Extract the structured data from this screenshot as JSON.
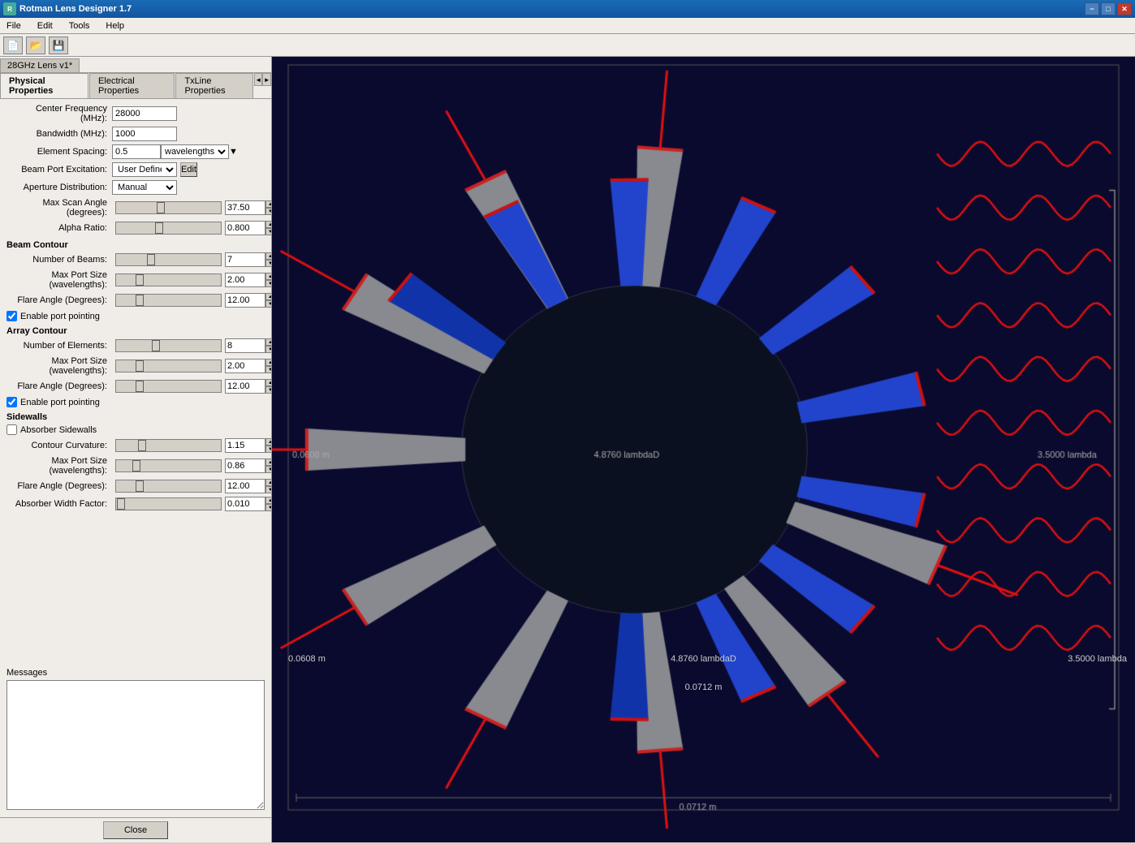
{
  "titleBar": {
    "title": "Rotman Lens Designer 1.7",
    "minimizeLabel": "−",
    "maximizeLabel": "□",
    "closeLabel": "✕"
  },
  "menuBar": {
    "items": [
      "File",
      "Edit",
      "Tools",
      "Help"
    ]
  },
  "toolbar": {
    "buttons": [
      "📄",
      "📂",
      "💾"
    ]
  },
  "lensTab": {
    "label": "28GHz Lens v1*"
  },
  "tabs": {
    "items": [
      "Physical Properties",
      "Electrical Properties",
      "TxLine Properties"
    ],
    "activeIndex": 0,
    "navPrev": "◄",
    "navNext": "►"
  },
  "fields": {
    "centerFreq": {
      "label": "Center Frequency (MHz):",
      "value": "28000"
    },
    "bandwidth": {
      "label": "Bandwidth (MHz):",
      "value": "1000"
    },
    "elementSpacing": {
      "label": "Element Spacing:",
      "value": "0.5",
      "units": "wavelengths"
    },
    "beamPortExcitation": {
      "label": "Beam Port Excitation:",
      "value": "User Defined",
      "buttonLabel": "Edit"
    },
    "apertureDistribution": {
      "label": "Aperture Distribution:",
      "value": "Manual"
    },
    "maxScanAngle": {
      "label": "Max Scan Angle (degrees):",
      "value": "37.50"
    },
    "alphaRatio": {
      "label": "Alpha Ratio:",
      "value": "0.800"
    }
  },
  "beamContour": {
    "title": "Beam Contour",
    "numberOfBeams": {
      "label": "Number of Beams:",
      "value": "7"
    },
    "maxPortSize": {
      "label": "Max Port Size (wavelengths):",
      "value": "2.00"
    },
    "flareAngle": {
      "label": "Flare Angle (Degrees):",
      "value": "12.00"
    },
    "enablePortPointing": {
      "label": "Enable port pointing",
      "checked": true
    }
  },
  "arrayContour": {
    "title": "Array Contour",
    "numberOfElements": {
      "label": "Number of Elements:",
      "value": "8"
    },
    "maxPortSize": {
      "label": "Max Port Size (wavelengths):",
      "value": "2.00"
    },
    "flareAngle": {
      "label": "Flare Angle (Degrees):",
      "value": "12.00"
    },
    "enablePortPointing": {
      "label": "Enable port pointing",
      "checked": true
    }
  },
  "sidewalls": {
    "title": "Sidewalls",
    "absorberSidewalls": {
      "label": "Absorber Sidewalls",
      "checked": false
    },
    "contourCurvature": {
      "label": "Contour Curvature:",
      "value": "1.15"
    },
    "maxPortSize": {
      "label": "Max Port Size (wavelengths):",
      "value": "0.86"
    },
    "flareAngle": {
      "label": "Flare Angle (Degrees):",
      "value": "12.00"
    },
    "absorberWidthFactor": {
      "label": "Absorber Width Factor:",
      "value": "0.010"
    }
  },
  "messages": {
    "title": "Messages",
    "content": ""
  },
  "closeButton": {
    "label": "Close"
  },
  "diagram": {
    "leftLabel": "0.0608 m",
    "centerLabel": "4.8760 lambdaD",
    "rightLabel": "3.5000 lambda",
    "bottomLabel": "0.0712 m"
  }
}
